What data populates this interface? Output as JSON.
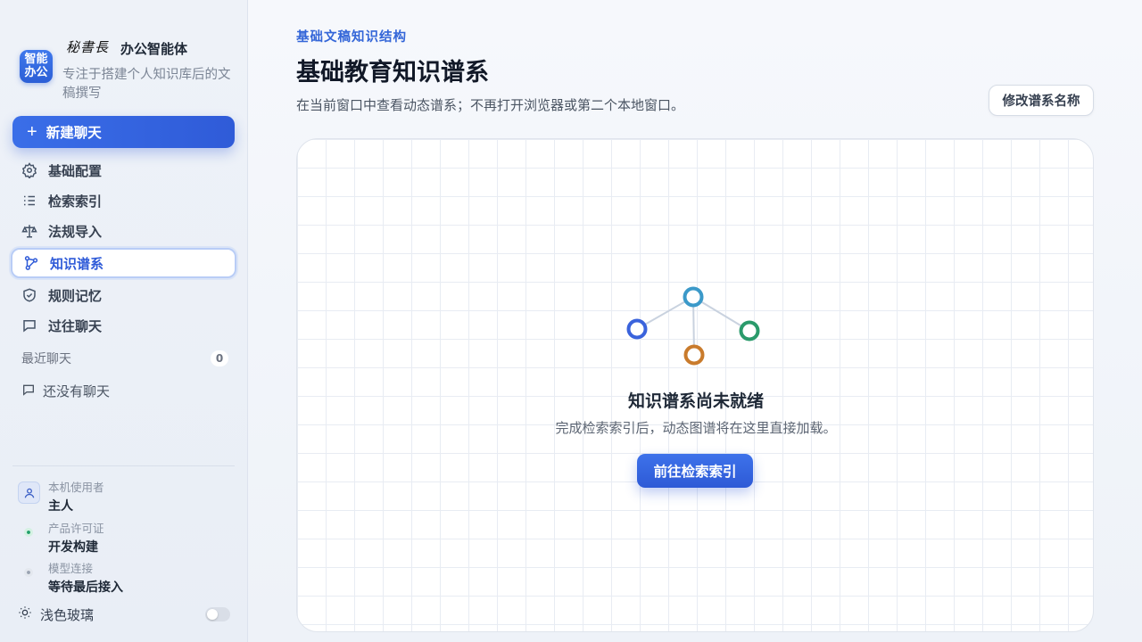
{
  "brand": {
    "signature": "秘書長",
    "title": "办公智能体",
    "logo_text_line1": "智能",
    "logo_text_line2": "办公",
    "subtitle": "专注于搭建个人知识库后的文稿撰写",
    "accent_color": "#2f5bd8"
  },
  "sidebar": {
    "new_chat_label": "新建聊天",
    "items": [
      {
        "label": "基础配置",
        "icon": "gear-icon"
      },
      {
        "label": "检索索引",
        "icon": "list-icon"
      },
      {
        "label": "法规导入",
        "icon": "scale-icon"
      },
      {
        "label": "知识谱系",
        "icon": "graph-icon",
        "active": true
      },
      {
        "label": "规则记忆",
        "icon": "shield-icon"
      },
      {
        "label": "过往聊天",
        "icon": "chat-bubble-icon"
      }
    ],
    "recent": {
      "title": "最近聊天",
      "count": "0",
      "empty_label": "还没有聊天"
    },
    "meta": {
      "user_label": "本机使用者",
      "user_value": "主人",
      "license_label": "产品许可证",
      "license_value": "开发构建",
      "license_status_color": "#22a06b",
      "model_label": "模型连接",
      "model_value": "等待最后接入",
      "model_status_color": "#9aa3b2"
    },
    "theme": {
      "label": "浅色玻璃",
      "enabled": false
    }
  },
  "main": {
    "eyebrow": "基础文稿知识结构",
    "title": "基础教育知识谱系",
    "description": "在当前窗口中查看动态谱系；不再打开浏览器或第二个本地窗口。",
    "rename_button": "修改谱系名称",
    "empty_state": {
      "title": "知识谱系尚未就绪",
      "subtitle": "完成检索索引后，动态图谱将在这里直接加载。",
      "action": "前往检索索引",
      "node_colors": [
        "#3b99c9",
        "#3a63dc",
        "#2a9a6b",
        "#c97b2c"
      ]
    }
  }
}
